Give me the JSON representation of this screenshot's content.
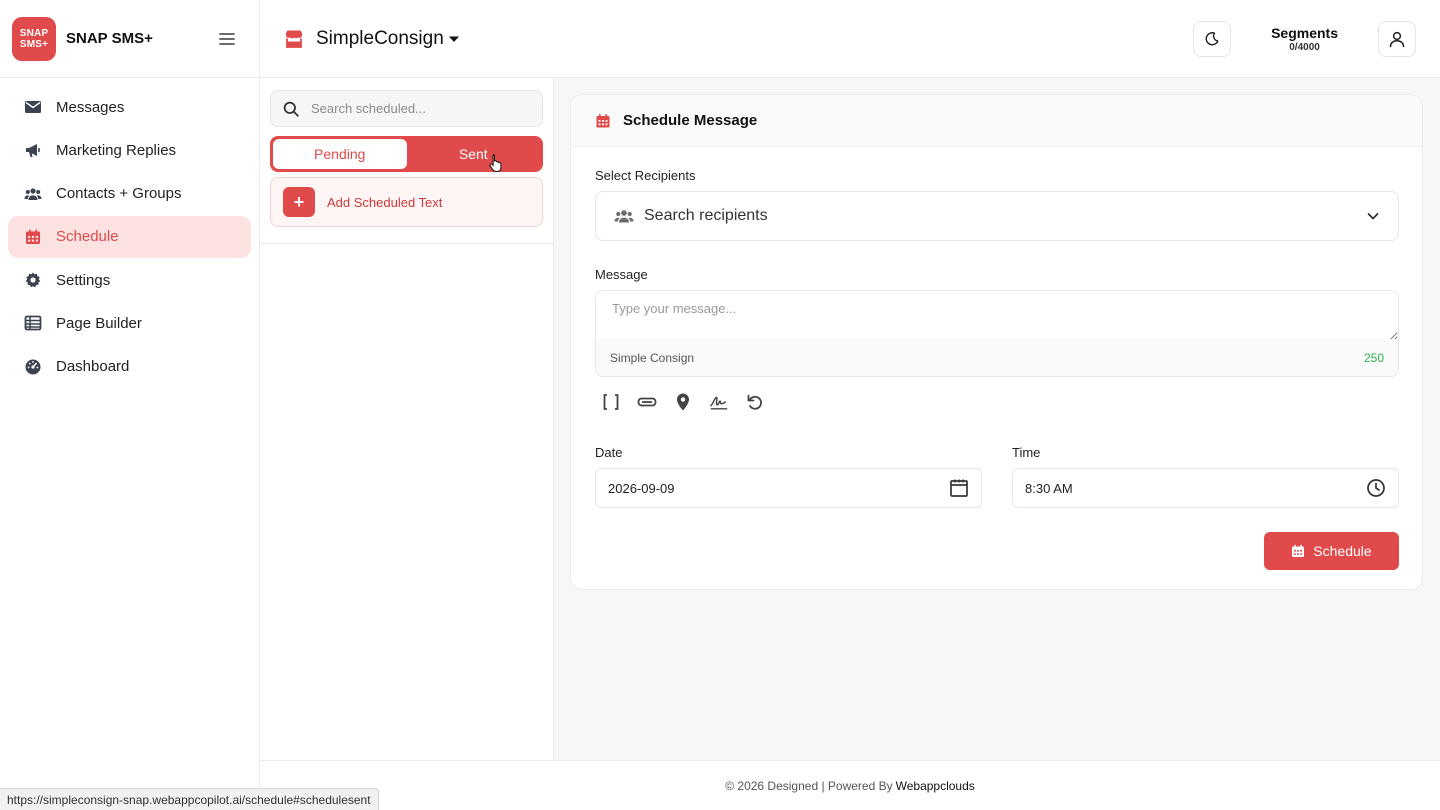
{
  "brand": {
    "logo_line1": "SNAP",
    "logo_line2": "SMS+",
    "name": "SNAP SMS+"
  },
  "sidebar": {
    "items": [
      {
        "label": "Messages",
        "icon": "envelope-icon"
      },
      {
        "label": "Marketing Replies",
        "icon": "megaphone-icon"
      },
      {
        "label": "Contacts + Groups",
        "icon": "users-icon"
      },
      {
        "label": "Schedule",
        "icon": "calendar-icon",
        "active": true
      },
      {
        "label": "Settings",
        "icon": "gear-icon"
      },
      {
        "label": "Page Builder",
        "icon": "table-list-icon"
      },
      {
        "label": "Dashboard",
        "icon": "gauge-icon"
      }
    ]
  },
  "topbar": {
    "store_name": "SimpleConsign",
    "segments_label": "Segments",
    "segments_value": "0/4000"
  },
  "scheduled_panel": {
    "search_placeholder": "Search scheduled...",
    "tab_pending": "Pending",
    "tab_sent": "Sent",
    "add_label": "Add Scheduled Text"
  },
  "schedule_form": {
    "title": "Schedule Message",
    "recipients_label": "Select Recipients",
    "recipients_placeholder": "Search recipients",
    "message_label": "Message",
    "message_placeholder": "Type your message...",
    "signature": "Simple Consign",
    "char_count": "250",
    "date_label": "Date",
    "date_value": "2026-09-09",
    "time_label": "Time",
    "time_value": "8:30 AM",
    "submit_label": "Schedule"
  },
  "footer": {
    "text": "© 2026 Designed | Powered By",
    "brand": "Webappclouds"
  },
  "status_url": "https://simpleconsign-snap.webappcopilot.ai/schedule#schedulesent",
  "colors": {
    "accent": "#e04a4a",
    "accent_light": "#fde2e2",
    "count_green": "#2fb44a"
  }
}
